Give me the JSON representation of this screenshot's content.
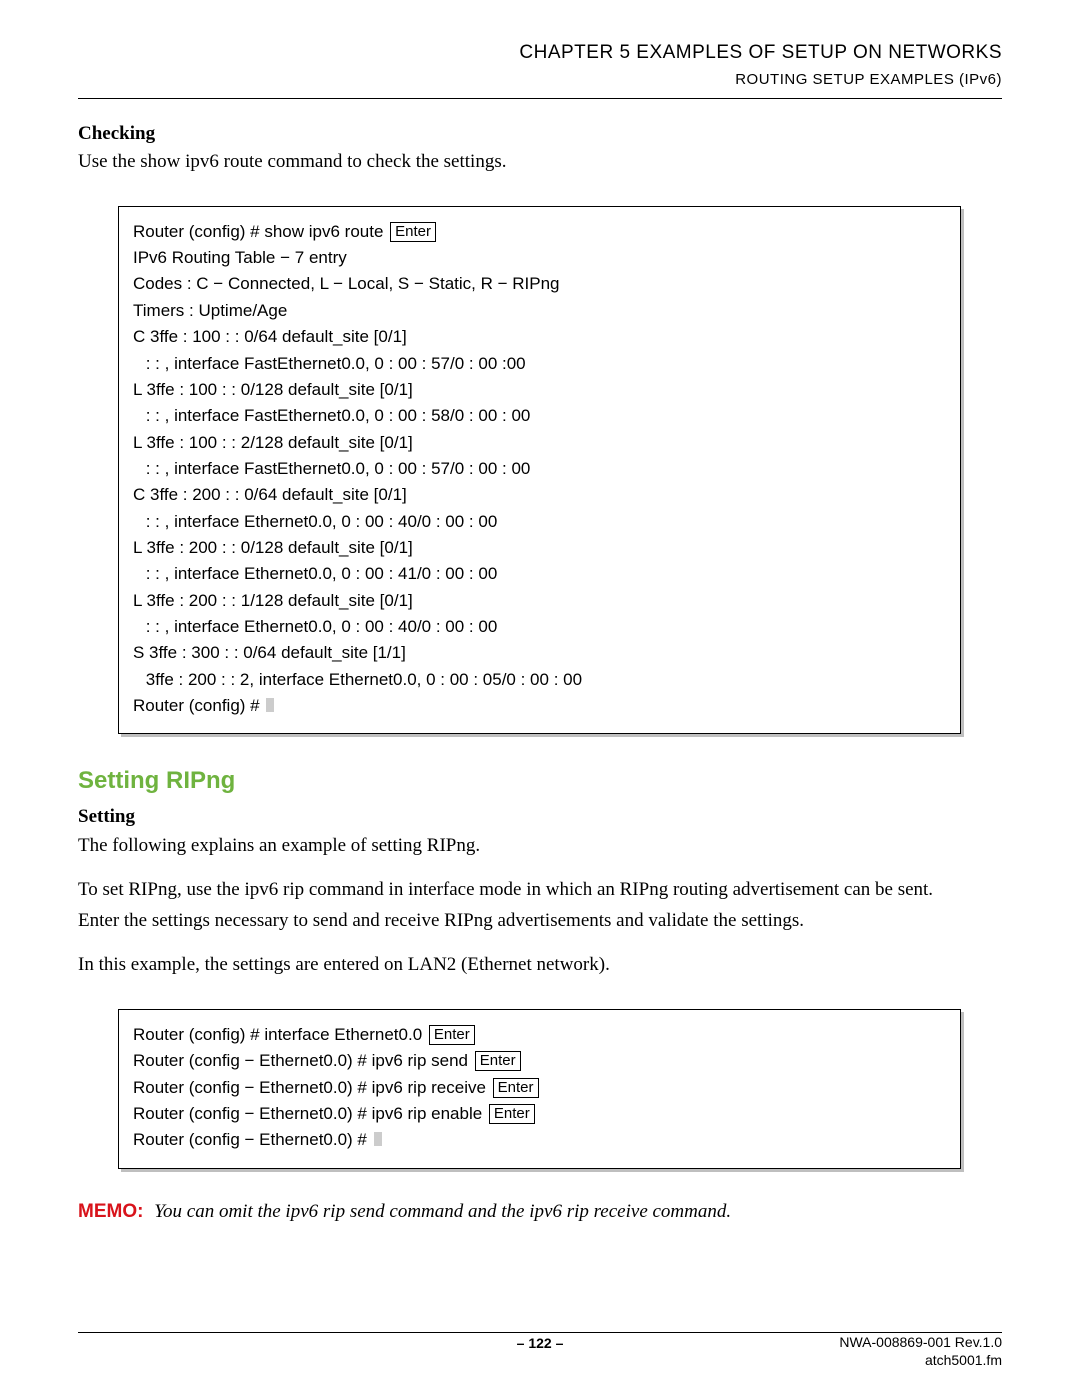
{
  "header": {
    "chapter": "CHAPTER 5   EXAMPLES OF SETUP ON NETWORKS",
    "sub": "ROUTING SETUP EXAMPLES (IPv6)"
  },
  "checking": {
    "heading": "Checking",
    "text": "Use the show ipv6 route command to check the settings."
  },
  "code1": {
    "line1_prefix": "Router (config) # show ipv6 route ",
    "enter": "Enter",
    "l2": "IPv6 Routing Table − 7 entry",
    "l3": "Codes : C − Connected, L − Local, S − Static, R − RIPng",
    "l4": "Timers : Uptime/Age",
    "l5": "C 3ffe : 100 : : 0/64 default_site [0/1]",
    "l6": " : : , interface FastEthernet0.0, 0 : 00 : 57/0 : 00 :00",
    "l7": "L 3ffe : 100 : : 0/128 default_site [0/1]",
    "l8": " : : , interface FastEthernet0.0, 0 : 00 : 58/0 : 00 : 00",
    "l9": "L 3ffe : 100 : : 2/128 default_site [0/1]",
    "l10": " : : , interface FastEthernet0.0, 0 : 00 : 57/0 : 00 : 00",
    "l11": "C 3ffe : 200 : : 0/64 default_site [0/1]",
    "l12": " : : , interface Ethernet0.0, 0 : 00 : 40/0 : 00 : 00",
    "l13": "L 3ffe : 200 : : 0/128 default_site [0/1]",
    "l14": " : : , interface Ethernet0.0, 0 : 00 : 41/0 : 00 : 00",
    "l15": "L 3ffe : 200 : : 1/128 default_site [0/1]",
    "l16": " : : , interface Ethernet0.0, 0 : 00 : 40/0 : 00 : 00",
    "l17": "S 3ffe : 300 : : 0/64 default_site [1/1]",
    "l18": " 3ffe : 200 : : 2, interface Ethernet0.0, 0 : 00 : 05/0 : 00 : 00",
    "l19": "Router (config) # "
  },
  "section": {
    "heading": "Setting RIPng"
  },
  "setting": {
    "heading": "Setting",
    "p1": "The following explains an example of setting RIPng.",
    "p2": "To set RIPng, use the ipv6 rip command in interface mode in which an RIPng routing advertisement can be sent.",
    "p3": "Enter the settings necessary to send and receive RIPng advertisements and validate the settings.",
    "p4": "In this example, the settings are entered on LAN2 (Ethernet network)."
  },
  "code2": {
    "enter": "Enter",
    "l1": "Router (config) # interface Ethernet0.0 ",
    "l2": "Router (config − Ethernet0.0) # ipv6 rip send ",
    "l3": "Router (config − Ethernet0.0) # ipv6 rip receive ",
    "l4": "Router (config − Ethernet0.0) # ipv6 rip enable ",
    "l5": "Router (config − Ethernet0.0) # "
  },
  "memo": {
    "label": "MEMO:",
    "text": "You can omit the ipv6 rip send command and the ipv6 rip receive command."
  },
  "footer": {
    "page": "– 122 –",
    "rev": "NWA-008869-001 Rev.1.0",
    "file": "atch5001.fm"
  }
}
